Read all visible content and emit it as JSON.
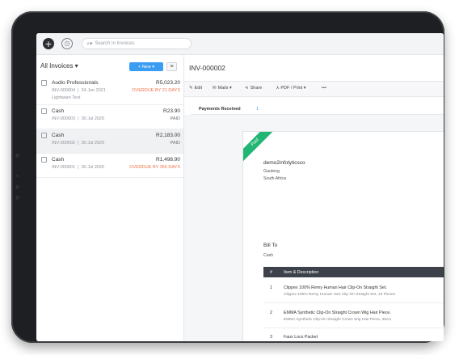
{
  "topbar": {
    "search_placeholder": "Search in Invoices",
    "add_icon": "plus-circle-icon",
    "history_icon": "clock-icon"
  },
  "sidebar": {
    "title": "All Invoices ▾",
    "new_button": "+ New ▾",
    "menu_icon": "hamburger-icon",
    "items": [
      {
        "name": "Audio Professionals",
        "amount": "R5,023.20",
        "number": "INV-000004",
        "date": "24 Jun 2021",
        "status": "OVERDUE BY 21 DAYS",
        "note": "Lightware Test"
      },
      {
        "name": "Cash",
        "amount": "R23.90",
        "number": "INV-000003",
        "date": "30 Jul 2020",
        "status": "PAID",
        "note": ""
      },
      {
        "name": "Cash",
        "amount": "R2,183.00",
        "number": "INV-000002",
        "date": "30 Jul 2020",
        "status": "PAID",
        "note": ""
      },
      {
        "name": "Cash",
        "amount": "R1,498.90",
        "number": "INV-000001",
        "date": "30 Jul 2020",
        "status": "OVERDUE BY 350 DAYS",
        "note": ""
      }
    ]
  },
  "detail": {
    "title": "INV-000002",
    "toolbar": {
      "edit": "Edit",
      "mails": "Mails ▾",
      "share": "Share",
      "pdf": "PDF / Print ▾",
      "more": "•••"
    },
    "payments_label": "Payments Received",
    "payments_count": "1",
    "document": {
      "ribbon": "Paid",
      "org_name": "demo2infolyticsco",
      "org_region": "Gauteng",
      "org_country": "South Africa",
      "bill_to_label": "Bill To",
      "bill_to_name": "Cash",
      "columns": {
        "num": "#",
        "desc": "Item & Description"
      },
      "rows": [
        {
          "num": "1",
          "title": "Clippex 100% Remy Human Hair Clip-On Straight Set.",
          "desc": "Clippex 100% Remy Human Hair Clip-On Straight Set, 10 Pieces"
        },
        {
          "num": "2",
          "title": "EMMA Synthetic Clip-On Straight Crown Wig Hair Piece.",
          "desc": "EMMA Synthetic Clip-On Straight Crown Wig Hair Piece, 35cm"
        },
        {
          "num": "3",
          "title": "Faux Locs Packet",
          "desc": ""
        }
      ]
    }
  },
  "colors": {
    "accent": "#3b9df2",
    "overdue": "#f0724a",
    "paid_ribbon": "#22b573",
    "table_header": "#3d4149"
  }
}
